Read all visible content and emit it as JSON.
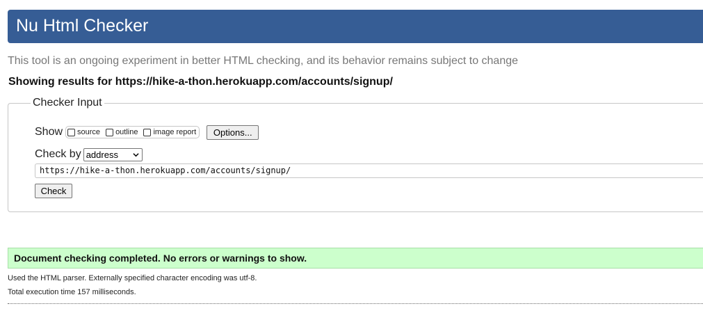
{
  "header": {
    "title": "Nu Html Checker"
  },
  "tagline": "This tool is an ongoing experiment in better HTML checking, and its behavior remains subject to change",
  "showing_results": "Showing results for https://hike-a-thon.herokuapp.com/accounts/signup/",
  "checker_input": {
    "legend": "Checker Input",
    "show_label": "Show",
    "options": [
      {
        "label": "source",
        "checked": false
      },
      {
        "label": "outline",
        "checked": false
      },
      {
        "label": "image report",
        "checked": false
      }
    ],
    "options_button": "Options...",
    "check_by_label": "Check by",
    "check_by_value": "address",
    "url_value": "https://hike-a-thon.herokuapp.com/accounts/signup/",
    "check_button": "Check"
  },
  "result": {
    "message": "Document checking completed. No errors or warnings to show.",
    "parser_note": "Used the HTML parser. Externally specified character encoding was utf-8.",
    "execution_time": "Total execution time 157 milliseconds."
  },
  "colors": {
    "header_bg": "#365d95",
    "success_bg": "#ccffcc",
    "tagline": "#777777"
  }
}
